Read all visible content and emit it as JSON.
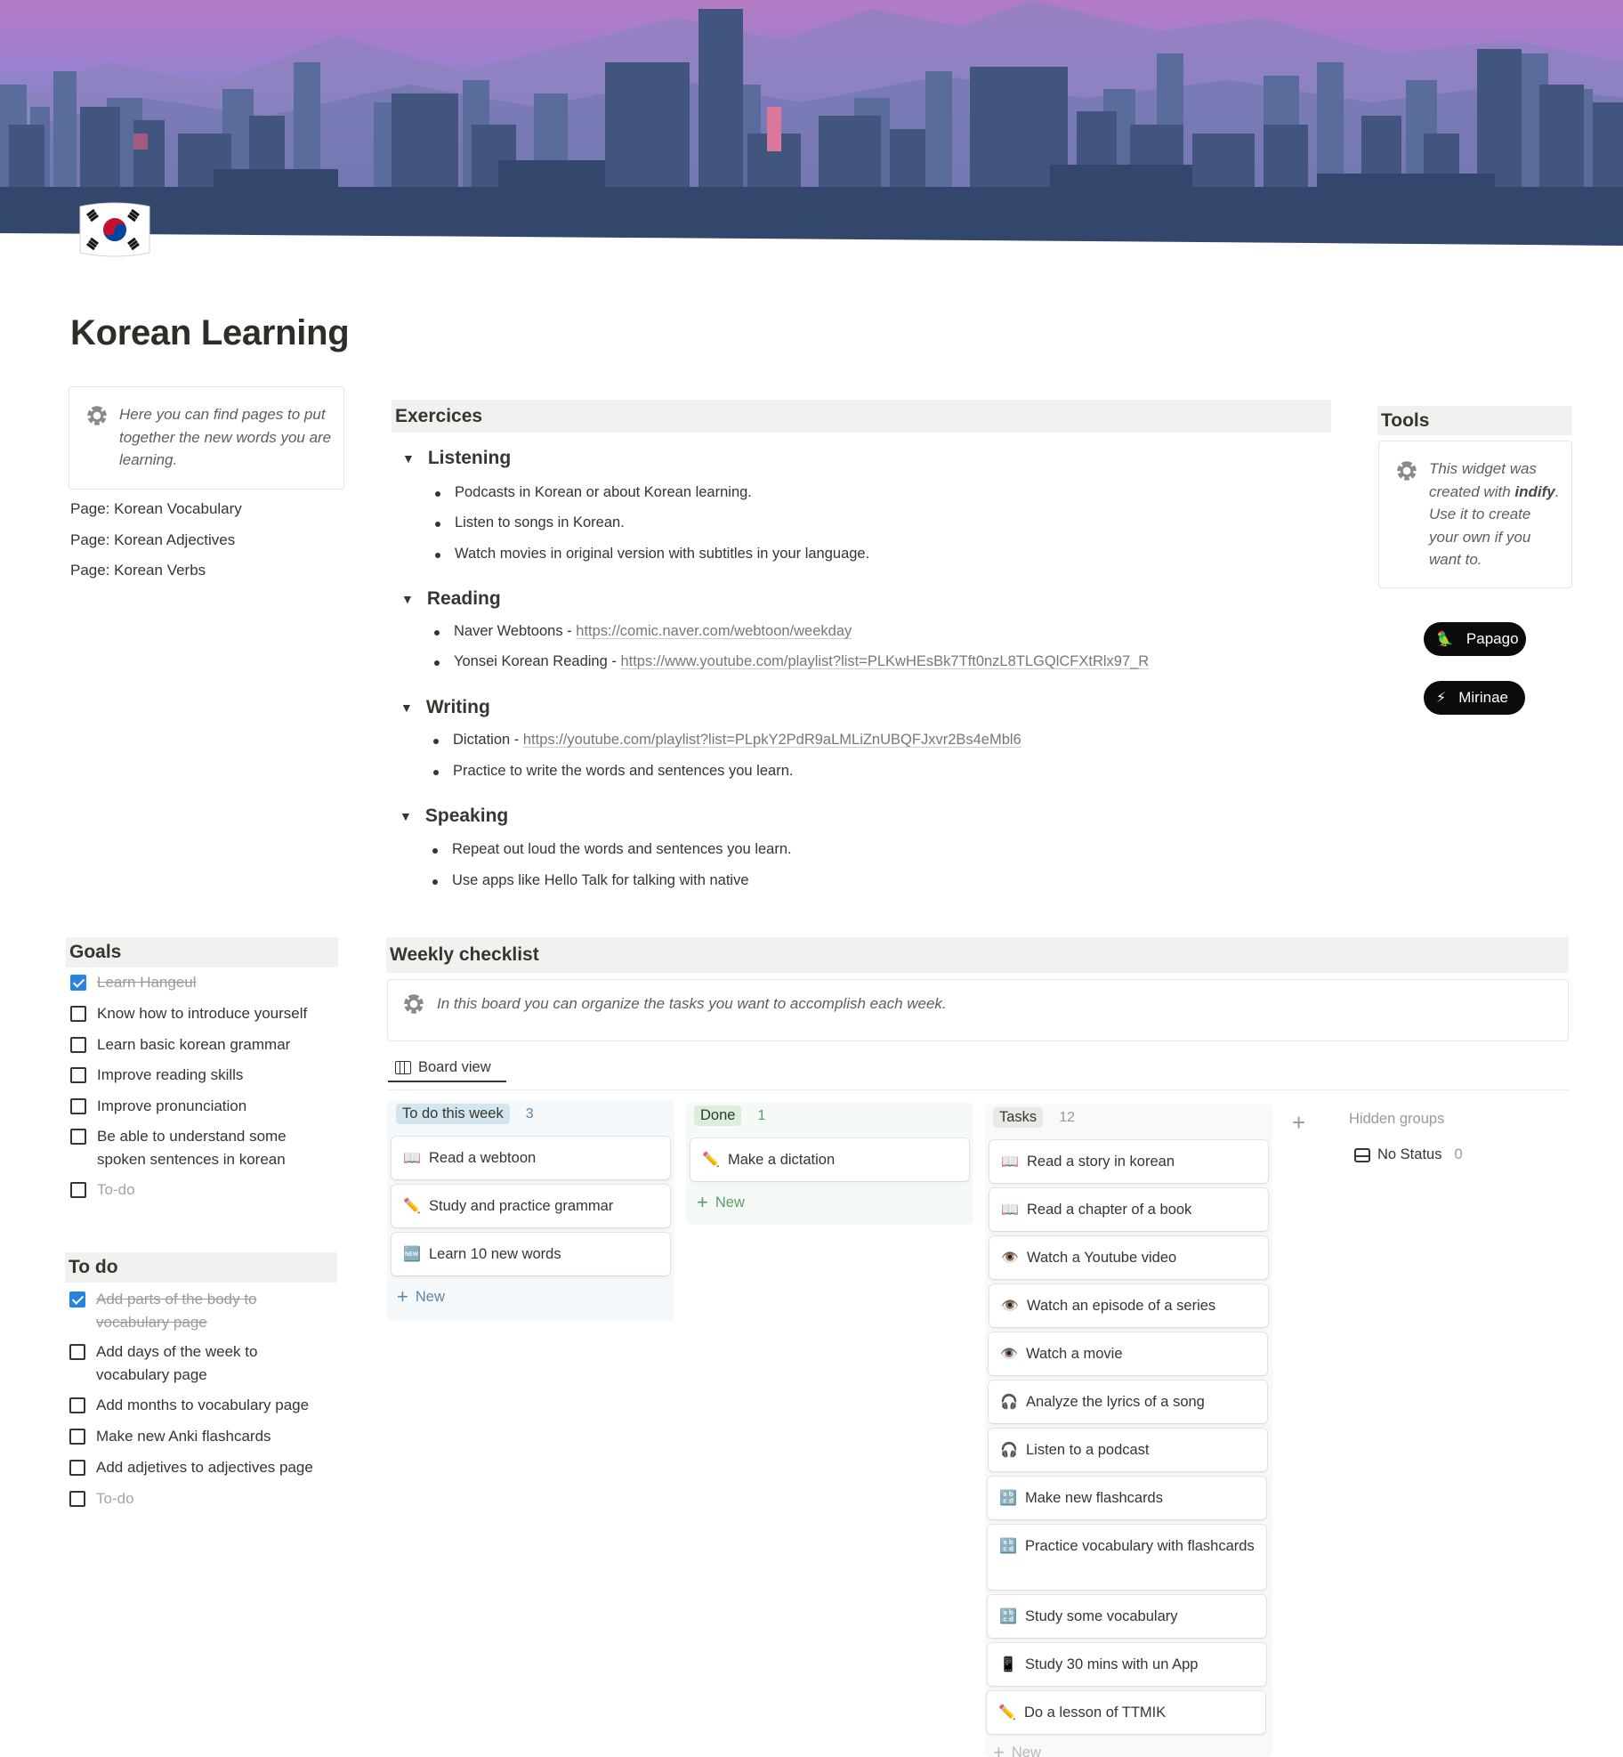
{
  "page": {
    "title": "Korean Learning",
    "icon": "south-korea-flag-icon"
  },
  "intro_callout": {
    "icon": "gear-icon",
    "text": "Here you can find pages to put together the new words you are learning."
  },
  "page_links": [
    {
      "label": "Page: Korean Vocabulary"
    },
    {
      "label": "Page: Korean Adjectives"
    },
    {
      "label": "Page: Korean Verbs"
    }
  ],
  "exercices": {
    "heading": "Exercices",
    "sections": [
      {
        "title": "Listening",
        "items": [
          {
            "text": "Podcasts in Korean or about Korean learning.",
            "link": ""
          },
          {
            "text": "Listen to songs in Korean.",
            "link": ""
          },
          {
            "text": "Watch movies in original version with subtitles in your language.",
            "link": ""
          }
        ]
      },
      {
        "title": "Reading",
        "items": [
          {
            "text": "Naver Webtoons - ",
            "link": "https://comic.naver.com/webtoon/weekday"
          },
          {
            "text": "Yonsei Korean Reading - ",
            "link": "https://www.youtube.com/playlist?list=PLKwHEsBk7Tft0nzL8TLGQlCFXtRlx97_R"
          }
        ]
      },
      {
        "title": "Writing",
        "items": [
          {
            "text": "Dictation - ",
            "link": "https://youtube.com/playlist?list=PLpkY2PdR9aLMLiZnUBQFJxvr2Bs4eMbl6"
          },
          {
            "text": "Practice to write the words and sentences you learn.",
            "link": ""
          }
        ]
      },
      {
        "title": "Speaking",
        "items": [
          {
            "text": "Repeat out loud the words and sentences you learn.",
            "link": ""
          },
          {
            "text": "Use apps like Hello Talk for talking with native",
            "link": ""
          }
        ]
      }
    ]
  },
  "tools": {
    "heading": "Tools",
    "callout": {
      "icon": "gear-icon",
      "text_before": "This widget was created with ",
      "brand": "indify",
      "text_after": ". Use it to create your own if you want to."
    },
    "buttons": [
      {
        "label": "Papago",
        "icon": "parrot-icon"
      },
      {
        "label": "Mirinae",
        "icon": "lightning-icon"
      }
    ]
  },
  "goals": {
    "heading": "Goals",
    "items": [
      {
        "text": "Learn Hangeul",
        "checked": true
      },
      {
        "text": "Know how to introduce yourself",
        "checked": false
      },
      {
        "text": "Learn basic korean grammar",
        "checked": false
      },
      {
        "text": "Improve reading skills",
        "checked": false
      },
      {
        "text": "Improve pronunciation",
        "checked": false
      },
      {
        "text": "Be able to understand some spoken sentences in korean",
        "checked": false
      }
    ],
    "placeholder": "To-do"
  },
  "todo": {
    "heading": "To do",
    "items": [
      {
        "text": "Add parts of the body to vocabulary page",
        "checked": true
      },
      {
        "text": "Add days of the week to vocabulary page",
        "checked": false
      },
      {
        "text": "Add months to vocabulary page",
        "checked": false
      },
      {
        "text": "Make new Anki flashcards",
        "checked": false
      },
      {
        "text": "Add adjetives to adjectives page",
        "checked": false
      }
    ],
    "placeholder": "To-do"
  },
  "weekly": {
    "heading": "Weekly checklist",
    "callout": {
      "icon": "gear-icon",
      "text": "In this board you can organize the tasks you want to accomplish each week."
    },
    "view_tab": "Board view",
    "new_label": "New",
    "columns": [
      {
        "name": "To do this week",
        "count": "3",
        "color": "#d3e5ef",
        "cards": [
          {
            "icon": "open-book-icon",
            "glyph": "📖",
            "title": "Read a webtoon"
          },
          {
            "icon": "pencil-icon",
            "glyph": "✏️",
            "title": "Study and practice grammar"
          },
          {
            "icon": "new-badge-icon",
            "glyph": "🆕",
            "title": "Learn 10 new words"
          }
        ]
      },
      {
        "name": "Done",
        "count": "1",
        "color": "#dbeddb",
        "cards": [
          {
            "icon": "pencil-icon",
            "glyph": "✏️",
            "title": "Make a dictation"
          }
        ]
      },
      {
        "name": "Tasks",
        "count": "12",
        "color": "#e9e9e7",
        "cards": [
          {
            "icon": "open-book-icon",
            "glyph": "📖",
            "title": "Read a story in korean"
          },
          {
            "icon": "open-book-icon",
            "glyph": "📖",
            "title": "Read a chapter of a book"
          },
          {
            "icon": "eye-icon",
            "glyph": "👁️",
            "title": "Watch a Youtube video"
          },
          {
            "icon": "eye-icon",
            "glyph": "👁️",
            "title": "Watch an episode of a series"
          },
          {
            "icon": "eye-icon",
            "glyph": "👁️",
            "title": "Watch a movie"
          },
          {
            "icon": "headphones-icon",
            "glyph": "🎧",
            "title": "Analyze the lyrics of a song"
          },
          {
            "icon": "headphones-icon",
            "glyph": "🎧",
            "title": "Listen to a podcast"
          },
          {
            "icon": "abcd-icon",
            "glyph": "🔡",
            "title": "Make new flashcards"
          },
          {
            "icon": "abcd-icon",
            "glyph": "🔡",
            "title": "Practice vocabulary with flashcards"
          },
          {
            "icon": "abcd-icon",
            "glyph": "🔡",
            "title": "Study some vocabulary"
          },
          {
            "icon": "mobile-phone-icon",
            "glyph": "📱",
            "title": "Study 30 mins with un App"
          },
          {
            "icon": "pencil-icon",
            "glyph": "✏️",
            "title": "Do a lesson of TTMIK"
          }
        ]
      }
    ],
    "hidden_groups_label": "Hidden groups",
    "hidden_groups": [
      {
        "name": "No Status",
        "count": "0"
      }
    ]
  }
}
